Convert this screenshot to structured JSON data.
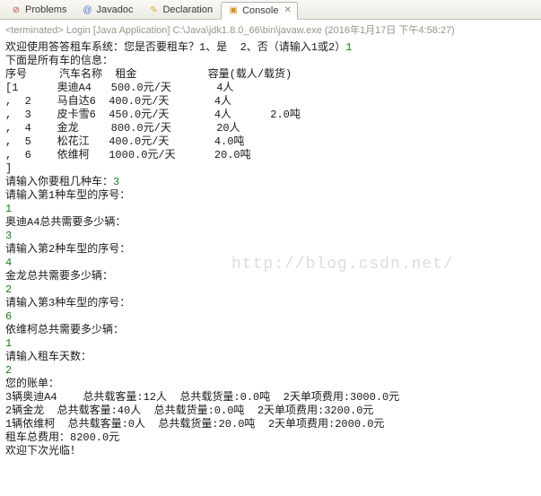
{
  "tabs": [
    {
      "icon": "⊘",
      "label": "Problems"
    },
    {
      "icon": "@",
      "label": "Javadoc"
    },
    {
      "icon": "✎",
      "label": "Declaration"
    },
    {
      "icon": "▣",
      "label": "Console"
    }
  ],
  "terminated": "<terminated> Login [Java Application] C:\\Java\\jdk1.8.0_66\\bin\\javaw.exe (2016年1月17日 下午4:58:27)",
  "lines": [
    {
      "t": "欢迎使用答答租车系统：您是否要租车？1、是  2、否（请输入1或2）",
      "in": "1"
    },
    {
      "t": "下面是所有车的信息："
    },
    {
      "t": "序号     汽车名称  租金           容量(载人/载货)"
    },
    {
      "t": "[1      奥迪A4   500.0元/天       4人"
    },
    {
      "t": ",  2    马自达6  400.0元/天       4人"
    },
    {
      "t": ",  3    皮卡雪6  450.0元/天       4人      2.0吨"
    },
    {
      "t": ",  4    金龙     800.0元/天       20人"
    },
    {
      "t": ",  5    松花江   400.0元/天       4.0吨"
    },
    {
      "t": ",  6    依维柯   1000.0元/天      20.0吨"
    },
    {
      "t": "]"
    },
    {
      "t": "请输入你要租几种车：",
      "in": "3"
    },
    {
      "t": "请输入第1种车型的序号："
    },
    {
      "in": "1"
    },
    {
      "t": "奥迪A4总共需要多少辆："
    },
    {
      "in": "3"
    },
    {
      "t": "请输入第2种车型的序号："
    },
    {
      "in": "4"
    },
    {
      "t": "金龙总共需要多少辆："
    },
    {
      "in": "2"
    },
    {
      "t": "请输入第3种车型的序号："
    },
    {
      "in": "6"
    },
    {
      "t": "依维柯总共需要多少辆："
    },
    {
      "in": "1"
    },
    {
      "t": "请输入租车天数："
    },
    {
      "in": "2"
    },
    {
      "t": "您的账单："
    },
    {
      "t": "3辆奥迪A4    总共载客量:12人  总共载货量:0.0吨  2天单项费用:3000.0元"
    },
    {
      "t": "2辆金龙  总共载客量:40人  总共载货量:0.0吨  2天单项费用:3200.0元"
    },
    {
      "t": "1辆依维柯  总共载客量:0人  总共载货量:20.0吨  2天单项费用:2000.0元"
    },
    {
      "t": "租车总费用：8200.0元"
    },
    {
      "t": "欢迎下次光临！"
    }
  ],
  "watermark": "http://blog.csdn.net/"
}
